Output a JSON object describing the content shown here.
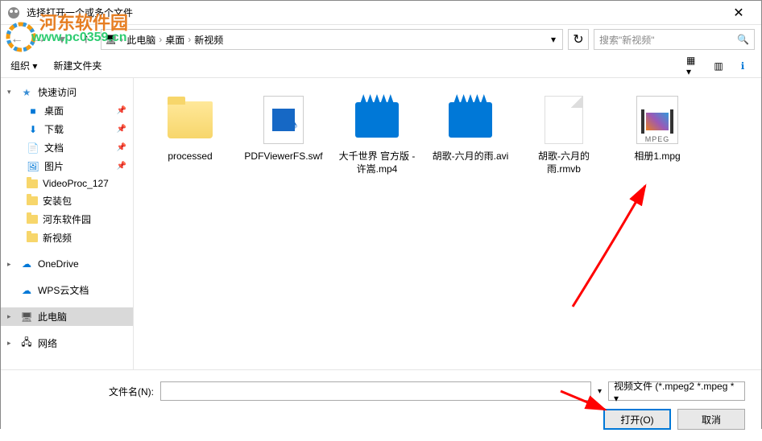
{
  "window": {
    "title": "选择打开一个或多个文件",
    "close": "✕"
  },
  "breadcrumb": {
    "parts": [
      "此电脑",
      "桌面",
      "新视频"
    ],
    "sep": "›"
  },
  "search": {
    "placeholder": "搜索\"新视频\""
  },
  "toolbar": {
    "organize": "组织 ▾",
    "newfolder": "新建文件夹"
  },
  "sidebar": {
    "quick": "快速访问",
    "desktop": "桌面",
    "downloads": "下载",
    "documents": "文档",
    "pictures": "图片",
    "videoproc": "VideoProc_127",
    "install": "安装包",
    "hedong": "河东软件园",
    "newvideo": "新视频",
    "onedrive": "OneDrive",
    "wps": "WPS云文档",
    "thispc": "此电脑",
    "network": "网络"
  },
  "files": [
    {
      "name": "processed",
      "type": "folder"
    },
    {
      "name": "PDFViewerFS.swf",
      "type": "swf"
    },
    {
      "name": "大千世界 官方版 - 许嵩.mp4",
      "type": "video"
    },
    {
      "name": "胡歌-六月的雨.avi",
      "type": "video"
    },
    {
      "name": "胡歌-六月的雨.rmvb",
      "type": "blank"
    },
    {
      "name": "相册1.mpg",
      "type": "mpeg"
    }
  ],
  "footer": {
    "filename_label": "文件名(N):",
    "filter": "视频文件 (*.mpeg2 *.mpeg * ▾",
    "open": "打开(O)",
    "cancel": "取消"
  },
  "watermark": {
    "text": "河东软件园",
    "url": "www.pc0359.cn"
  }
}
